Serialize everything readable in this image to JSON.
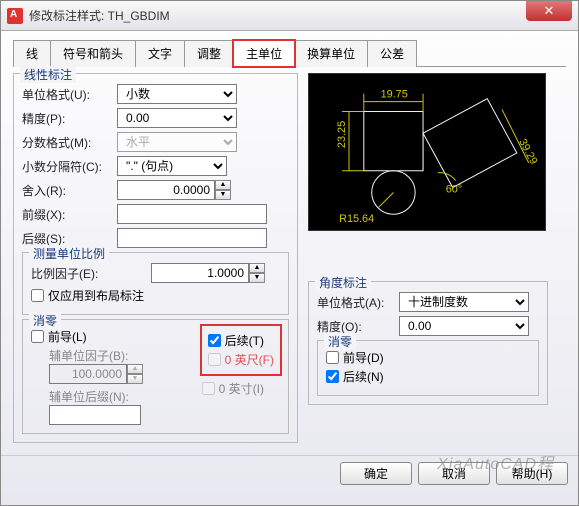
{
  "window": {
    "title": "修改标注样式: TH_GBDIM"
  },
  "tabs": [
    "线",
    "符号和箭头",
    "文字",
    "调整",
    "主单位",
    "换算单位",
    "公差"
  ],
  "active_tab": "主单位",
  "linear": {
    "legend": "线性标注",
    "unit_format_label": "单位格式(U):",
    "unit_format_value": "小数",
    "precision_label": "精度(P):",
    "precision_value": "0.00",
    "fraction_format_label": "分数格式(M):",
    "fraction_format_value": "水平",
    "decimal_sep_label": "小数分隔符(C):",
    "decimal_sep_value": "\".\" (句点)",
    "round_label": "舍入(R):",
    "round_value": "0.0000",
    "prefix_label": "前缀(X):",
    "prefix_value": "",
    "suffix_label": "后缀(S):",
    "suffix_value": ""
  },
  "scale": {
    "legend": "测量单位比例",
    "factor_label": "比例因子(E):",
    "factor_value": "1.0000",
    "layout_only_label": "仅应用到布局标注"
  },
  "zero": {
    "legend": "消零",
    "leading_label": "前导(L)",
    "trailing_label": "后续(T)",
    "aux_factor_label": "辅单位因子(B):",
    "aux_factor_value": "100.0000",
    "aux_suffix_label": "辅单位后缀(N):",
    "aux_suffix_value": "",
    "zero_feet_label": "0 英尺(F)",
    "zero_inch_label": "0 英寸(I)"
  },
  "angular": {
    "legend": "角度标注",
    "unit_format_label": "单位格式(A):",
    "unit_format_value": "十进制度数",
    "precision_label": "精度(O):",
    "precision_value": "0.00",
    "zero_legend": "消零",
    "leading_label": "前导(D)",
    "trailing_label": "后续(N)"
  },
  "buttons": {
    "ok": "确定",
    "cancel": "取消",
    "help": "帮助(H)"
  },
  "preview": {
    "dim_top": "19.75",
    "dim_left": "23.25",
    "dim_right": "39.29",
    "dim_angle": "60°",
    "dim_radius": "R15.64"
  },
  "watermark": "XiaAutoCAD程"
}
